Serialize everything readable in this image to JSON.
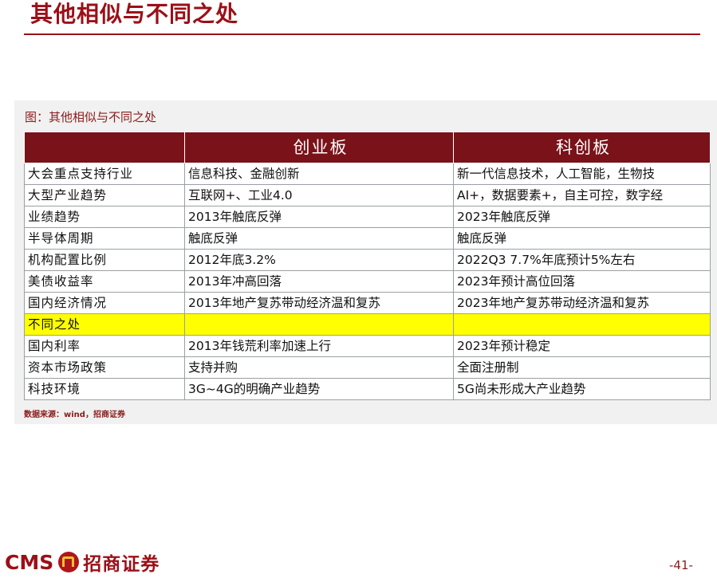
{
  "page_title": "其他相似与不同之处",
  "figure_caption": "图：其他相似与不同之处",
  "table": {
    "headers": [
      "",
      "创业板",
      "科创板"
    ],
    "rows": [
      {
        "label": "大会重点支持行业",
        "a": "信息科技、金融创新",
        "b": "新一代信息技术，人工智能，生物技",
        "highlight": false
      },
      {
        "label": "大型产业趋势",
        "a": "互联网+、工业4.0",
        "b": "AI+，数据要素+，自主可控，数字经",
        "highlight": false
      },
      {
        "label": "业绩趋势",
        "a": "2013年触底反弹",
        "b": "2023年触底反弹",
        "highlight": false
      },
      {
        "label": "半导体周期",
        "a": "触底反弹",
        "b": "触底反弹",
        "highlight": false
      },
      {
        "label": "机构配置比例",
        "a": "2012年底3.2%",
        "b": "2022Q3 7.7%年底预计5%左右",
        "highlight": false
      },
      {
        "label": "美债收益率",
        "a": "2013年冲高回落",
        "b": "2023年预计高位回落",
        "highlight": false
      },
      {
        "label": "国内经济情况",
        "a": "2013年地产复苏带动经济温和复苏",
        "b": "2023年地产复苏带动经济温和复苏",
        "highlight": false
      },
      {
        "label": "不同之处",
        "a": "",
        "b": "",
        "highlight": true
      },
      {
        "label": "国内利率",
        "a": "2013年钱荒利率加速上行",
        "b": "2023年预计稳定",
        "highlight": false
      },
      {
        "label": "资本市场政策",
        "a": "支持并购",
        "b": "全面注册制",
        "highlight": false
      },
      {
        "label": "科技环境",
        "a": "3G~4G的明确产业趋势",
        "b": "5G尚未形成大产业趋势",
        "highlight": false
      }
    ]
  },
  "source_note": "数据来源：wind，招商证券",
  "footer": {
    "logo_latin": "CMS",
    "logo_cn": "招商证券",
    "page_number": "-41-"
  },
  "colors": {
    "brand_red": "#9b0f17",
    "header_fill": "#7a1219",
    "highlight_yellow": "#ffff00"
  }
}
